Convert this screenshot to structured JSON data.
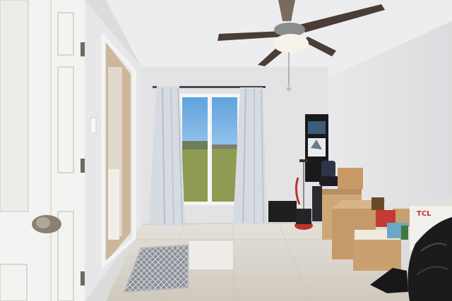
{
  "photo": {
    "box_brand": "TCL",
    "colors": {
      "wall": "#e6e6e8",
      "ceiling": "#ececee",
      "floor": "#d9d4cc",
      "door": "#f3f3f1",
      "curtain": "#d7dbe2",
      "sky": "#8cc0ea",
      "grass": "#8f9a52",
      "cardboard": "#c9a070",
      "trash_bag": "#1b1b1d",
      "fan_blade": "#4a3d38",
      "door_knob": "#8a7f70"
    }
  }
}
